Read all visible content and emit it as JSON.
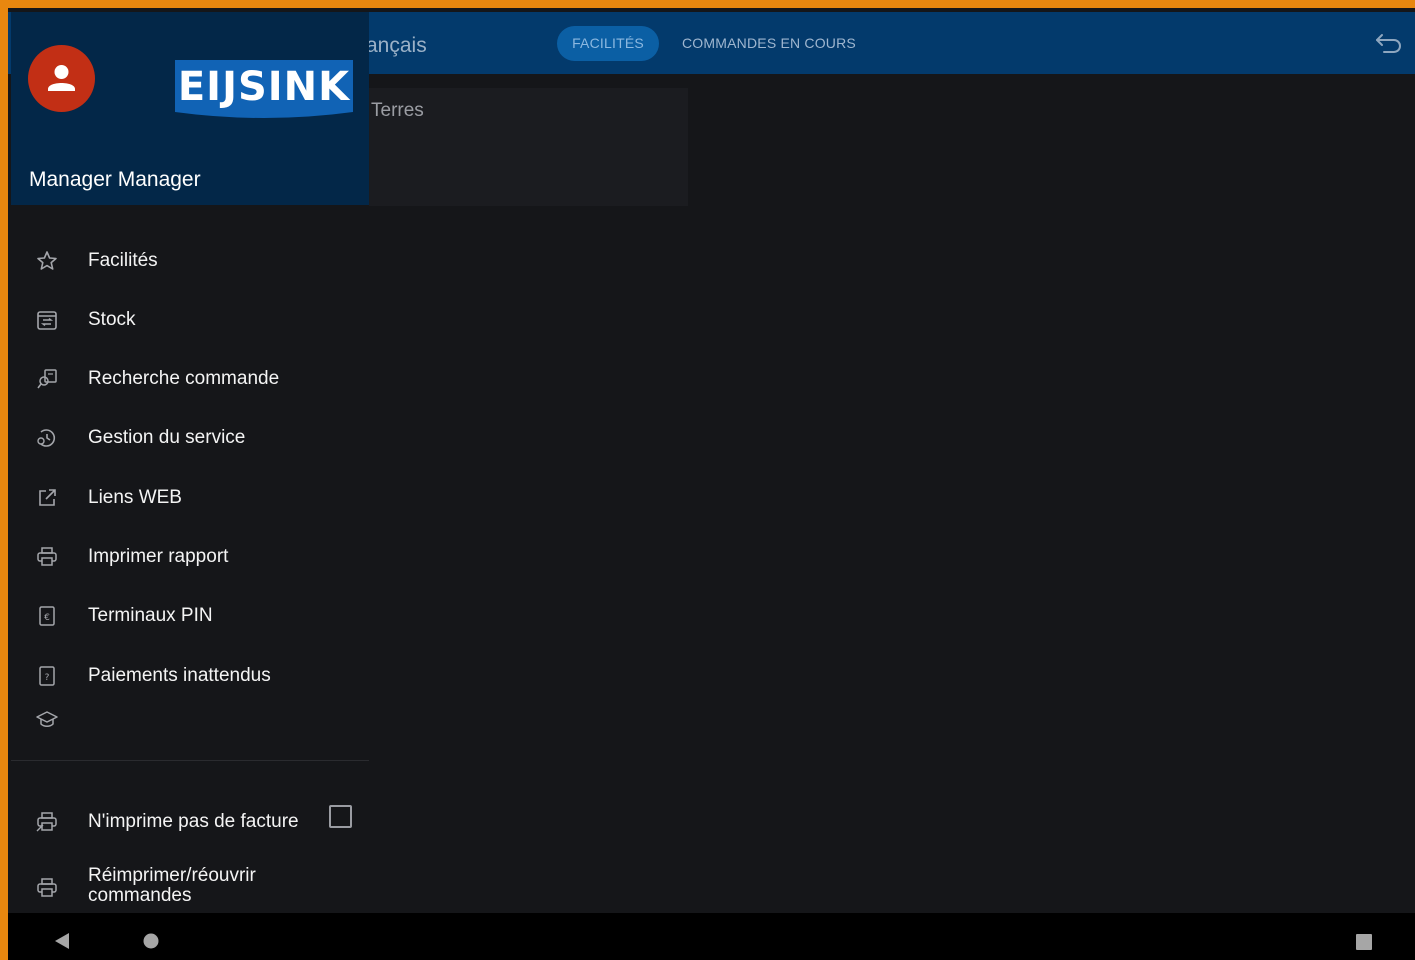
{
  "appbar": {
    "language_fragment": "ançais",
    "tabs": [
      {
        "label": "FACILITÉS",
        "active": true
      },
      {
        "label": "COMMANDES EN COURS",
        "active": false
      }
    ],
    "back_icon": "undo-arrow-icon"
  },
  "content": {
    "card_text": "Terres"
  },
  "drawer": {
    "logo_text": "EIJSINK",
    "username": "Manager Manager",
    "items": [
      {
        "label": "Facilités",
        "icon": "star-icon"
      },
      {
        "label": "Stock",
        "icon": "stock-icon"
      },
      {
        "label": "Recherche commande",
        "icon": "search-order-icon"
      },
      {
        "label": "Gestion du service",
        "icon": "service-icon"
      },
      {
        "label": "Liens WEB",
        "icon": "external-link-icon"
      },
      {
        "label": "Imprimer rapport",
        "icon": "printer-icon"
      },
      {
        "label": "Terminaux PIN",
        "icon": "pin-terminal-icon"
      },
      {
        "label": "Paiements inattendus",
        "icon": "unexpected-payment-icon"
      },
      {
        "label": "",
        "icon": "graduation-cap-icon"
      }
    ],
    "no_invoice": {
      "label": "N'imprime pas de facture",
      "checked": false,
      "icon": "printer-icon"
    },
    "reprint": {
      "line1": "Réimprimer/réouvrir",
      "line2": "commandes",
      "icon": "printer-icon"
    }
  },
  "colors": {
    "appbar": "#033a6c",
    "drawer_header": "#032748",
    "avatar": "#c22f15",
    "logo_blue": "#1163b5",
    "frame": "#e8870f"
  }
}
